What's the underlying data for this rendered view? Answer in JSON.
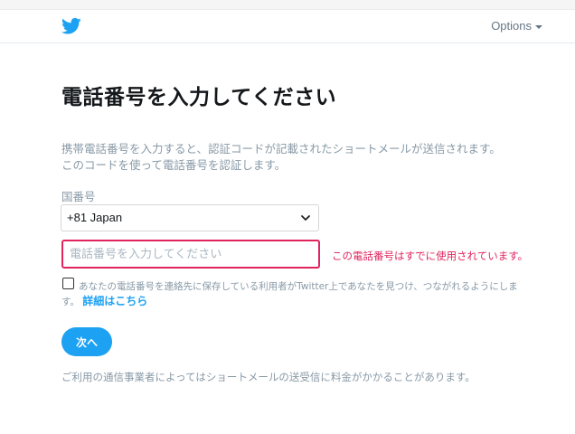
{
  "header": {
    "logo_icon": "twitter-bird-icon",
    "options_label": "Options"
  },
  "page": {
    "title": "電話番号を入力してください",
    "description_line1": "携帯電話番号を入力すると、認証コードが記載されたショートメールが送信されます。",
    "description_line2": "このコードを使って電話番号を認証します。"
  },
  "form": {
    "country_label": "国番号",
    "country_value": "+81 Japan",
    "phone_placeholder": "電話番号を入力してください",
    "phone_value": "",
    "error_text": "この電話番号はすでに使用されています。",
    "consent_text": "あなたの電話番号を連絡先に保存している利用者がTwitter上であなたを見つけ、つながれるようにします。",
    "consent_link": "詳細はこちら",
    "consent_checked": false,
    "next_label": "次へ",
    "footer_note": "ご利用の通信事業者によってはショートメールの送受信に料金がかかることがあります。"
  },
  "colors": {
    "brand": "#1da1f2",
    "error": "#e0245e",
    "muted_text": "#8899a6"
  }
}
